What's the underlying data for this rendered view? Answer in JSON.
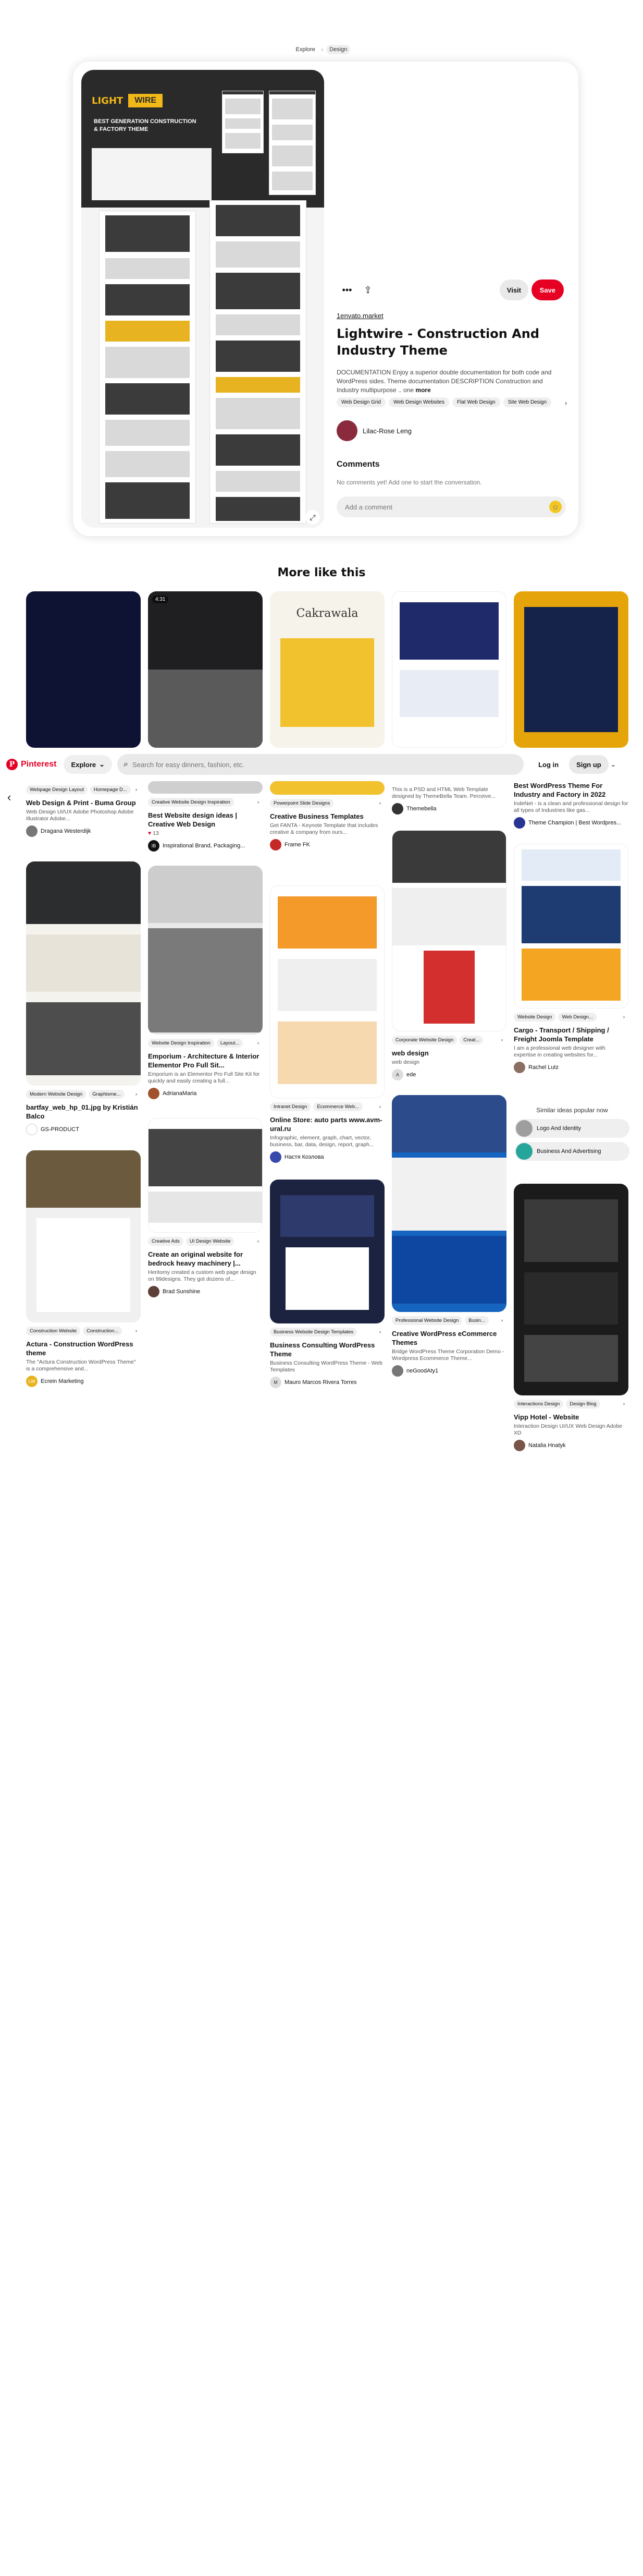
{
  "breadcrumb": [
    "Explore",
    "Design"
  ],
  "pin": {
    "image_hero": {
      "logo_left": "LIGHT",
      "logo_right": "WIRE",
      "tagline": "BEST GENERATION CONSTRUCTION & FACTORY THEME"
    },
    "visit_label": "Visit",
    "save_label": "Save",
    "source": "1envato.market",
    "title": "Lightwire - Construction And Industry Theme",
    "description": "DOCUMENTATION Enjoy a superior double documentation for both code and WordPress sides. Theme documentation DESCRIPTION Construction and Industry multipurpose .. one",
    "more_label": "more",
    "tags": [
      "Web Design Grid",
      "Web Design Websites",
      "Flat Web Design",
      "Site Web Design"
    ],
    "author": "Lilac-Rose Leng",
    "comments_heading": "Comments",
    "comments_empty": "No comments yet! Add one to start the conversation.",
    "comment_placeholder": "Add a comment"
  },
  "more_like_this": "More like this",
  "header": {
    "logo_text": "Pinterest",
    "explore_label": "Explore",
    "search_placeholder": "Search for easy dinners, fashion, etc.",
    "login_label": "Log in",
    "signup_label": "Sign up"
  },
  "grid": {
    "col1": [
      {
        "tags": [
          "Webpage Design Layout",
          "Homepage D..."
        ],
        "title": "Web Design & Print - Buma Group",
        "sub": "Web Design UI/UX Adobe Photoshop Adobe Illustrator Adobe...",
        "by": "Dragana Westerdijk"
      },
      {
        "tags": [
          "Modern Website Design",
          "Graphisme..."
        ],
        "title": "bartfay_web_hp_01.jpg by Kristián Balco",
        "sub": "",
        "by": "GS-PRODUCT"
      },
      {
        "tags": [
          "Construction Website",
          "Construction..."
        ],
        "title": "Actura - Construction WordPress theme",
        "sub": "The \"Actura Construction WordPress Theme\" is a comprehensive and...",
        "by": "Ecrein Marketing"
      }
    ],
    "col2": [
      {
        "tags": [
          "Creative Website Design Inspiration",
          "..."
        ],
        "title": "Best Website design ideas | Creative Web Design",
        "sub": "",
        "by": "Inspirational Brand, Packaging...",
        "likes": "13"
      },
      {
        "tags": [
          "Website Design Inspiration",
          "Layout..."
        ],
        "title": "Emporium - Architecture & Interior Elementor Pro Full Sit...",
        "sub": "Emporium is an Elementor Pro Full Site Kit for quickly and easily creating a full...",
        "by": "AdrianaMaria"
      },
      {
        "tags": [
          "Creative Ads",
          "UI Design Website",
          "..."
        ],
        "title": "Create an original website for bedrock heavy machinery |...",
        "sub": "Heritomy created a custom web page design on 99designs. They got dozens of...",
        "by": "Brad Sunshine"
      }
    ],
    "col3": [
      {
        "tags": [
          "Powerpoint Slide Designs",
          "Presen..."
        ],
        "title": "Creative Business Templates",
        "sub": "Get FANTA - Keynote Template that includes creative & company from ours...",
        "by": "Frame FK"
      },
      {
        "tags": [
          "Intranet Design",
          "Ecommerce Web..."
        ],
        "title": "Online Store: auto parts www.avm-ural.ru",
        "sub": "Infographic, element, graph, chart, vector, business, bar, data, design, report, graph...",
        "by": "Настя Козлова"
      },
      {
        "tags": [
          "Business Website Design Templates",
          "..."
        ],
        "title": "Business Consulting WordPress Theme",
        "sub": "Business Consulting WordPress Theme - Web Templates",
        "by": "Mauro Marcos Rivera Torres"
      }
    ],
    "col4": [
      {
        "tags": [],
        "title": "",
        "sub": "This is a PSD and HTML Web Template designed by ThemeBella Team. Perceive...",
        "by": "Themebella"
      },
      {
        "tags": [
          "Corporate Website Design",
          "Creat..."
        ],
        "title": "web design",
        "sub": "web design",
        "by": "ede"
      },
      {
        "tags": [
          "Professional Website Design",
          "Busin..."
        ],
        "title": "Creative WordPress eCommerce Themes",
        "sub": "Bridge WordPress Theme Corporation Demo - Wordpress Ecommerce Theme...",
        "by": "neGoodAty1"
      }
    ],
    "col5": [
      {
        "tags": [],
        "title": "Best WordPress Theme For Industry and Factory in 2022",
        "sub": "IndeNet - is a clean and professional design for all types of Industries like gas...",
        "by": "Theme Champion | Best Wordpres..."
      },
      {
        "tags": [
          "Website Design",
          "Web Design..."
        ],
        "title": "Cargo - Transport / Shipping / Freight Joomla Template",
        "sub": "I am a professional web designer with expertise in creating websites for...",
        "by": "Rachel Lutz"
      },
      {
        "tags": [
          "Interactions Design",
          "Design Blog",
          "..."
        ],
        "title": "Vipp Hotel - Website",
        "sub": "Interaction Design UI/UX Web Design Adobe XD",
        "by": "Natalia Hnatyk"
      }
    ]
  },
  "similar": {
    "heading": "Similar ideas popular now",
    "items": [
      "Logo And Identity",
      "Business And Advertising"
    ]
  },
  "colors": {
    "brand": "#e60023",
    "accent_yellow": "#f1b818",
    "surface": "#efefef"
  }
}
